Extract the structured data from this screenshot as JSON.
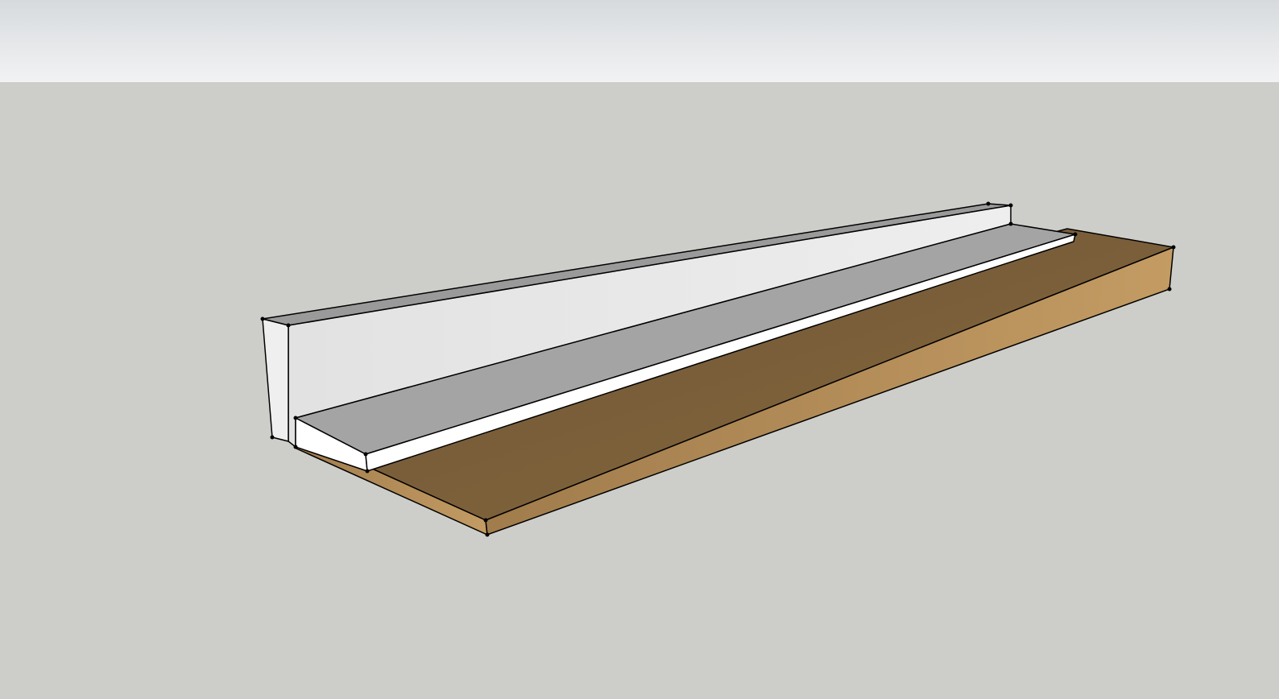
{
  "scene": {
    "sky_color": "#e6e8ea",
    "ground_color": "#cdcec9",
    "wall_face_color": "#e4e4e4",
    "wall_top_color": "#9a9a9a",
    "slab_top_color": "#a4a4a4",
    "slab_edge_color": "#ffffff",
    "soil_top_color": "#7a5f3d",
    "soil_side_color": "#b48f5b",
    "edge_color": "#000000"
  }
}
